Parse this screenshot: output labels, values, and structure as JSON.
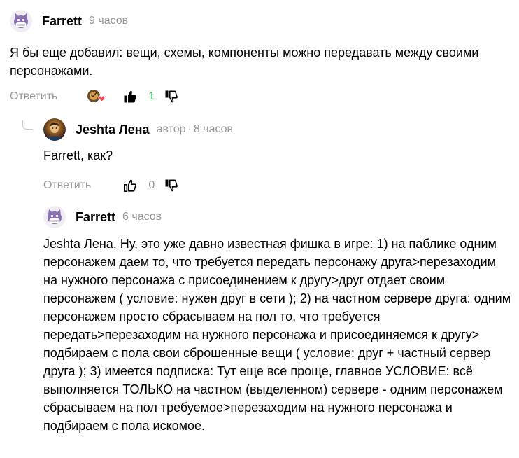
{
  "comments": [
    {
      "author": "Farrett",
      "time": "9 часов",
      "text": "Я бы еще добавил: вещи, схемы, компоненты можно передавать между своими персонажами.",
      "reply_label": "Ответить",
      "likes": "1",
      "liked": true,
      "reactions": true
    },
    {
      "author": "Jeshta Лена",
      "author_badge": "автор",
      "time": "8 часов",
      "text": "Farrett, как?",
      "reply_label": "Ответить",
      "likes": "0",
      "liked": false
    },
    {
      "author": "Farrett",
      "time": "6 часов",
      "text": "Jeshta Лена, Ну, это уже давно известная фишка в игре: 1) на паблике одним персонажем даем то, что требуется передать персонажу друга>перезаходим на нужного персонажа с присоединением к другу>друг отдает своим персонажем ( условие: нужен друг в сети ); 2) на частном сервере друга: одним персонажем просто сбрасываем на пол то, что требуется передать>перезаходим на нужного персонажа и присоединяемся к другу> подбираем с пола свои сброшенные вещи ( условие: друг + частный сервер друга ); 3) имеется подписка: Тут еще все проще, главное УСЛОВИЕ: всё выполняется ТОЛЬКО на частном (выделенном) сервере - одним персонажем сбрасываем на пол требуемое>перезаходим на нужного персонажа и подбираем с пола искомое."
    }
  ],
  "colors": {
    "like_count_active": "#2bb24c",
    "meta": "#999999",
    "avatar_purple": "#8a6fb5",
    "heart": "#ff3b47"
  }
}
